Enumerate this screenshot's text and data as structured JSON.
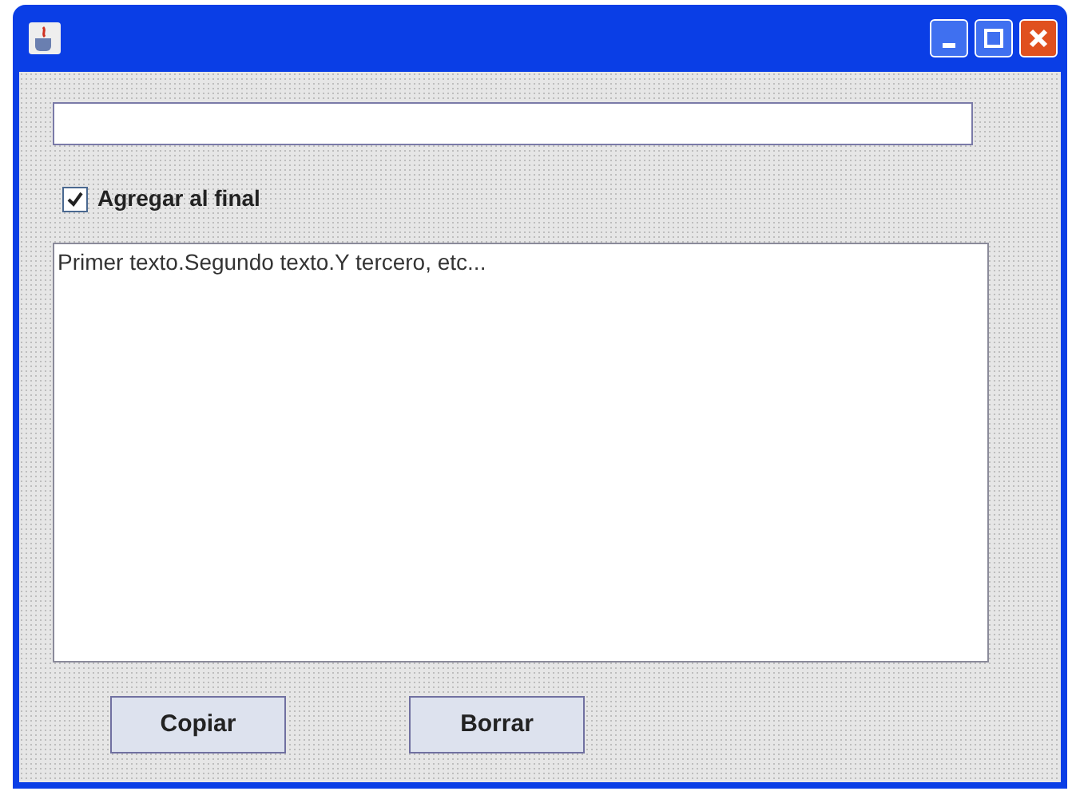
{
  "window": {
    "controls": [
      {
        "kind": "minimize"
      },
      {
        "kind": "maximize"
      },
      {
        "kind": "close"
      }
    ]
  },
  "checkbox": {
    "label": "Agregar al final",
    "checked": true
  },
  "text_area": {
    "value": "Primer texto.Segundo texto.Y tercero, etc..."
  },
  "buttons": [
    {
      "label": "Copiar"
    },
    {
      "label": "Borrar"
    }
  ]
}
